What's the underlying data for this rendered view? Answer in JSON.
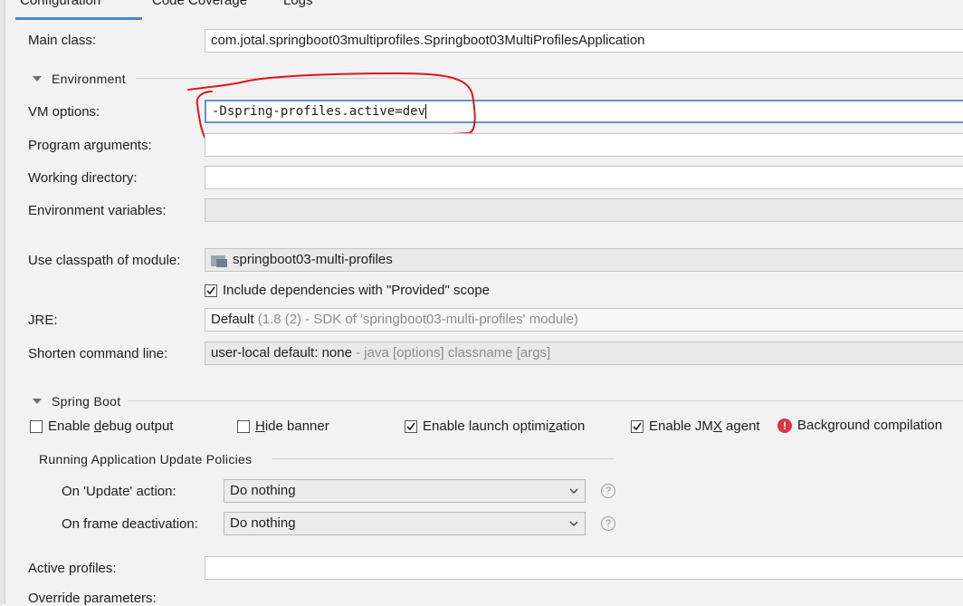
{
  "tabs": [
    {
      "label": "Configuration"
    },
    {
      "label": "Code Coverage"
    },
    {
      "label": "Logs"
    }
  ],
  "main_class": {
    "label": "Main class:",
    "value": "com.jotal.springboot03multiprofiles.Springboot03MultiProfilesApplication"
  },
  "environment": {
    "title": "Environment",
    "vm_options": {
      "label": "VM options:",
      "value": "-Dspring-profiles.active=dev"
    },
    "program_arguments": {
      "label": "Program arguments:",
      "value": ""
    },
    "working_directory": {
      "label": "Working directory:",
      "value": ""
    },
    "environment_variables": {
      "label": "Environment variables:",
      "value": ""
    }
  },
  "classpath": {
    "label": "Use classpath of module:",
    "value": "springboot03-multi-profiles"
  },
  "include_provided": {
    "label": "Include dependencies with \"Provided\" scope",
    "checked": true
  },
  "jre": {
    "label": "JRE:",
    "value": "Default",
    "detail": "(1.8 (2) - SDK of 'springboot03-multi-profiles' module)"
  },
  "shorten": {
    "label": "Shorten command line:",
    "value": "user-local default: none",
    "detail": "- java [options] classname [args]"
  },
  "spring_boot": {
    "title": "Spring Boot",
    "checkboxes": [
      {
        "label_pre": "Enable ",
        "mnemonic": "d",
        "label_post": "ebug output",
        "checked": false
      },
      {
        "label_pre": "",
        "mnemonic": "H",
        "label_post": "ide banner",
        "checked": false
      },
      {
        "label_pre": "Enable launch optimi",
        "mnemonic": "z",
        "label_post": "ation",
        "checked": true
      },
      {
        "label_pre": "Enable JM",
        "mnemonic": "X",
        "label_post": " agent",
        "checked": true
      }
    ],
    "background_compilation": {
      "label": "Background compilation"
    }
  },
  "update_policies": {
    "title": "Running Application Update Policies",
    "on_update": {
      "label": "On 'Update' action:",
      "value": "Do nothing"
    },
    "on_frame": {
      "label": "On frame deactivation:",
      "value": "Do nothing"
    },
    "help_glyph": "?"
  },
  "active_profiles": {
    "label": "Active profiles:",
    "value": ""
  },
  "override_parameters": {
    "label": "Override parameters:"
  },
  "colors": {
    "accent": "#4a88c7",
    "focus_border": "#5e95cf",
    "annotation": "#e0141e",
    "error": "#d9363e"
  },
  "icons": {
    "module": "folder-module-icon",
    "error": "error-circle-icon",
    "help": "help-circle-icon",
    "dropdown": "chevron-down-icon",
    "collapse": "triangle-down-icon"
  }
}
